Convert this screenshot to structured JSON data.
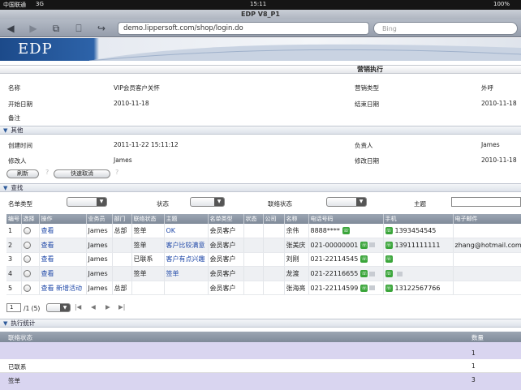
{
  "status_bar": {
    "carrier": "中国联通",
    "network": "3G",
    "time": "15:11",
    "battery": "100%"
  },
  "browser": {
    "title": "EDP V8_P1",
    "url": "demo.lippersoft.com/shop/login.do",
    "search_placeholder": "Bing",
    "icons": [
      "back-icon",
      "forward-icon",
      "tabs-icon",
      "bookmarks-icon",
      "share-icon"
    ]
  },
  "banner": {
    "logo": "EDP"
  },
  "page": {
    "title": "营销执行",
    "info": {
      "name_label": "名称",
      "name_value": "VIP会员客户关怀",
      "type_label": "营销类型",
      "type_value": "外呼",
      "start_label": "开始日期",
      "start_value": "2010-11-18",
      "end_label": "结束日期",
      "end_value": "2010-11-18",
      "remark_label": "备注"
    },
    "other": {
      "section_title": "其他",
      "created_label": "创建时间",
      "created_value": "2011-11-22 15:11:12",
      "owner_label": "负责人",
      "owner_value": "James",
      "modifier_label": "修改人",
      "modifier_value": "James",
      "modified_label": "修改日期",
      "modified_value": "2010-11-18"
    },
    "buttons": {
      "refresh": "刷新",
      "quick_cancel": "快速取消"
    },
    "filter": {
      "section_title": "查找",
      "list_type_label": "名单类型",
      "status_label": "状态",
      "contact_status_label": "联络状态",
      "subject_label": "主题"
    },
    "table": {
      "columns": [
        "编号",
        "选择",
        "操作",
        "业务员",
        "部门",
        "联络状态",
        "主题",
        "名单类型",
        "状态",
        "公司",
        "名称",
        "电话号码",
        "手机",
        "电子邮件"
      ],
      "rows": [
        {
          "id": "1",
          "action": "查看",
          "action2": "",
          "rep": "James",
          "dept": "总部",
          "contact": "签单",
          "subject": "OK",
          "list_type": "会员客户",
          "name": "余伟",
          "phone": "8888****",
          "mobile": "1393454545",
          "email": ""
        },
        {
          "id": "2",
          "action": "查看",
          "action2": "",
          "rep": "James",
          "dept": "",
          "contact": "签单",
          "subject": "客户比较满意",
          "list_type": "会员客户",
          "name": "张美庆",
          "phone": "021-00000001",
          "mobile": "13911111111",
          "email": "zhang@hotmail.com"
        },
        {
          "id": "3",
          "action": "查看",
          "action2": "",
          "rep": "James",
          "dept": "",
          "contact": "已联系",
          "subject": "客户有点兴趣",
          "list_type": "会员客户",
          "name": "刘刚",
          "phone": "021-22114545",
          "mobile": "",
          "email": ""
        },
        {
          "id": "4",
          "action": "查看",
          "action2": "",
          "rep": "James",
          "dept": "",
          "contact": "签单",
          "subject": "签单",
          "list_type": "会员客户",
          "name": "龙渡",
          "phone": "021-22116655",
          "mobile": "",
          "email": ""
        },
        {
          "id": "5",
          "action": "查看",
          "action2": "新增活动",
          "rep": "James",
          "dept": "总部",
          "contact": "",
          "subject": "",
          "list_type": "会员客户",
          "name": "张海亮",
          "phone": "021-22114599",
          "mobile": "13122567766",
          "email": ""
        }
      ]
    },
    "pager": {
      "page": "1",
      "total": "/1 (5)"
    },
    "stats": {
      "section_title": "执行统计",
      "columns": [
        "联络状态",
        "数量"
      ],
      "rows": [
        {
          "status": "",
          "count": "1"
        },
        {
          "status": "已联系",
          "count": "1"
        },
        {
          "status": "签单",
          "count": "3"
        }
      ]
    }
  },
  "colors": {
    "header_blue": "#2d63a9",
    "link": "#1f48a8",
    "phone_green": "#3aa53a",
    "stats_purple": "#d9d5f0"
  }
}
